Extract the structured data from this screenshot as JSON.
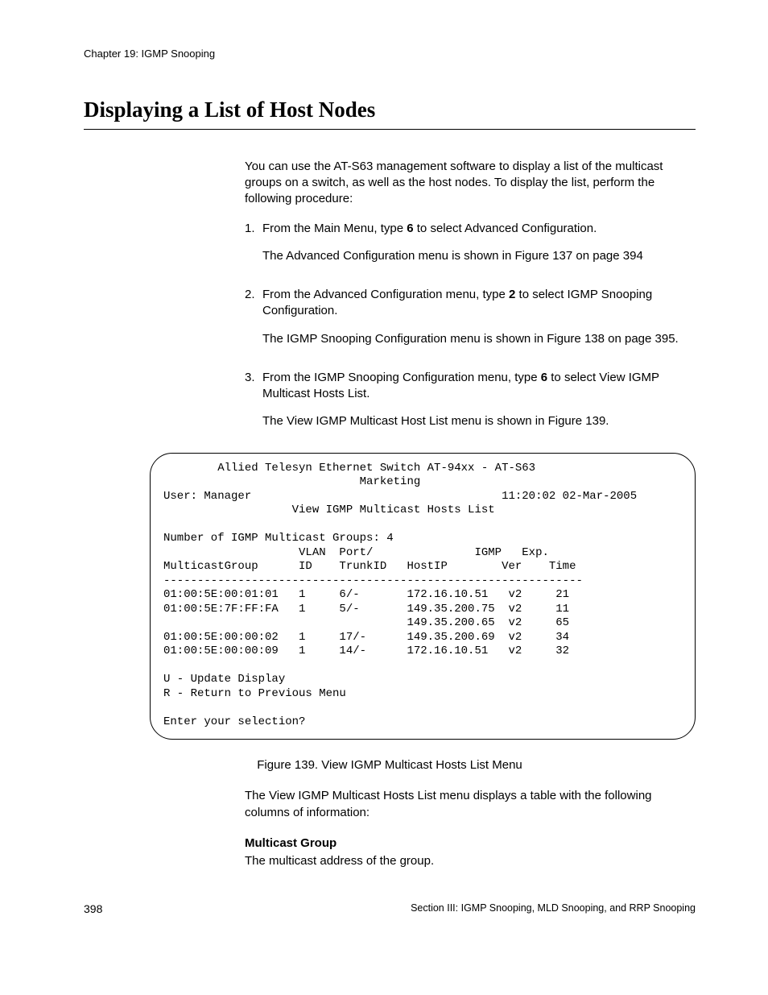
{
  "header": {
    "chapter": "Chapter 19: IGMP Snooping"
  },
  "title": "Displaying a List of Host Nodes",
  "intro": "You can use the AT-S63 management software to display a list of the multicast groups on a switch, as well as the host nodes. To display the list, perform the following procedure:",
  "steps": [
    {
      "num": "1.",
      "line_pre": "From the Main Menu, type ",
      "bold": "6",
      "line_post": " to select Advanced Configuration.",
      "after": "The Advanced Configuration menu is shown in Figure 137 on page 394"
    },
    {
      "num": "2.",
      "line_pre": "From the Advanced Configuration menu, type ",
      "bold": "2",
      "line_post": " to select IGMP Snooping Configuration.",
      "after": "The IGMP Snooping Configuration menu is shown in Figure 138 on page 395."
    },
    {
      "num": "3.",
      "line_pre": "From the IGMP Snooping Configuration menu, type ",
      "bold": "6",
      "line_post": " to select View IGMP Multicast Hosts List.",
      "after": "The View IGMP Multicast Host List menu is shown in Figure 139."
    }
  ],
  "terminal": {
    "title_line": "        Allied Telesyn Ethernet Switch AT-94xx - AT-S63",
    "subtitle": "                             Marketing",
    "user_line": "User: Manager                                     11:20:02 02-Mar-2005",
    "menu_title": "                   View IGMP Multicast Hosts List",
    "count_line": "Number of IGMP Multicast Groups: 4",
    "hdr1": "                    VLAN  Port/               IGMP   Exp.",
    "hdr2": "MulticastGroup      ID    TrunkID   HostIP        Ver    Time",
    "sep": "--------------------------------------------------------------",
    "row1": "01:00:5E:00:01:01   1     6/-       172.16.10.51   v2     21",
    "row2": "01:00:5E:7F:FF:FA   1     5/-       149.35.200.75  v2     11",
    "row3": "                                    149.35.200.65  v2     65",
    "row4": "01:00:5E:00:00:02   1     17/-      149.35.200.69  v2     34",
    "row5": "01:00:5E:00:00:09   1     14/-      172.16.10.51   v2     32",
    "opt_u": "U - Update Display",
    "opt_r": "R - Return to Previous Menu",
    "prompt": "Enter your selection?"
  },
  "figure_caption": "Figure 139. View IGMP Multicast Hosts List Menu",
  "after_figure": "The View IGMP Multicast Hosts List menu displays a table with the following columns of information:",
  "term_label": "Multicast Group",
  "term_desc": "The multicast address of the group.",
  "footer": {
    "page_num": "398",
    "section": "Section III: IGMP Snooping, MLD Snooping, and RRP Snooping"
  }
}
